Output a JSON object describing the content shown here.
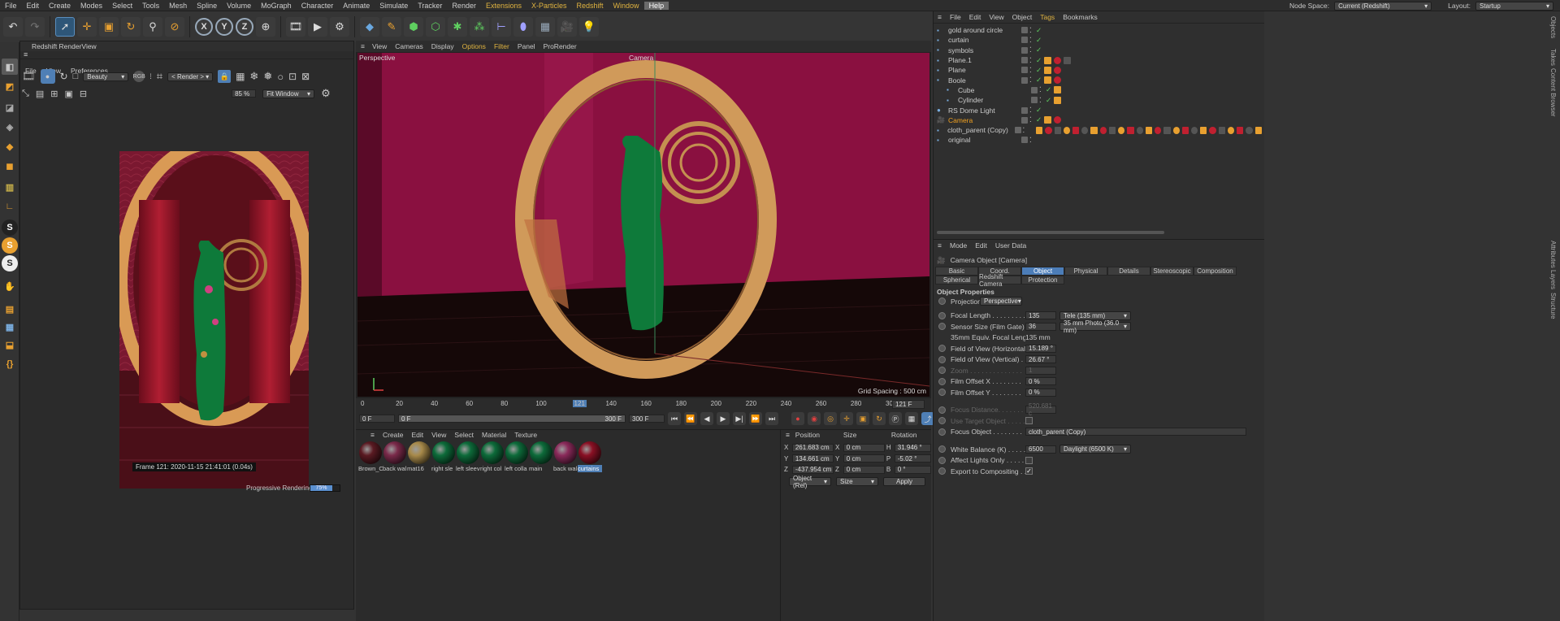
{
  "menu": [
    "File",
    "Edit",
    "Create",
    "Modes",
    "Select",
    "Tools",
    "Mesh",
    "Spline",
    "Volume",
    "MoGraph",
    "Character",
    "Animate",
    "Simulate",
    "Tracker",
    "Render",
    "Extensions",
    "X-Particles",
    "Redshift",
    "Window",
    "Help"
  ],
  "topright": {
    "node_space_label": "Node Space:",
    "node_space_value": "Current (Redshift)",
    "layout_label": "Layout:",
    "layout_value": "Startup"
  },
  "renderview": {
    "title": "Redshift RenderView",
    "menu": [
      "File",
      "View",
      "Preferences"
    ],
    "aov": "Beauty",
    "render_mode": "< Render >",
    "zoom": "85 %",
    "fit": "Fit Window",
    "frame_info": "Frame  121:  2020-11-15  21:41:01  (0.04s)",
    "status": "Progressive Rendering...",
    "progress_text": "75%"
  },
  "viewport": {
    "menu": [
      "View",
      "Cameras",
      "Display",
      "Options",
      "Filter",
      "Panel",
      "ProRender"
    ],
    "label": "Perspective",
    "camera_label": "Camera",
    "grid": "Grid Spacing : 500 cm"
  },
  "timeline": {
    "ticks": [
      "0",
      "20",
      "40",
      "60",
      "80",
      "100",
      "121",
      "140",
      "160",
      "180",
      "200",
      "220",
      "240",
      "260",
      "280",
      "300"
    ],
    "current_frame": "121 F",
    "start": "0 F",
    "start2": "0 F",
    "end": "300 F",
    "end2": "300 F"
  },
  "materials": {
    "menu": [
      "Create",
      "Edit",
      "View",
      "Select",
      "Material",
      "Texture"
    ],
    "items": [
      "Brown_C",
      "back wal",
      "mat16",
      "right sle",
      "left sleev",
      "right col",
      "left colla",
      "main",
      "back wal",
      "curtains"
    ],
    "colors": [
      "#5a1a22",
      "#7a2a4a",
      "#a88a4a",
      "#0d6b3a",
      "#0d6b3a",
      "#0d6b3a",
      "#0d6b3a",
      "#0d6b3a",
      "#8a2a5a",
      "#8a1024"
    ]
  },
  "coords": {
    "headers": [
      "Position",
      "Size",
      "Rotation"
    ],
    "rows": [
      {
        "a": "X",
        "p": "261.683 cm",
        "b": "X",
        "s": "0 cm",
        "c": "H",
        "r": "31.946 °"
      },
      {
        "a": "Y",
        "p": "134.661 cm",
        "b": "Y",
        "s": "0 cm",
        "c": "P",
        "r": "-5.02 °"
      },
      {
        "a": "Z",
        "p": "-437.954 cm",
        "b": "Z",
        "s": "0 cm",
        "c": "B",
        "r": "0 °"
      }
    ],
    "mode": "Object (Rel)",
    "size_mode": "Size",
    "apply": "Apply"
  },
  "objects": {
    "menu": [
      "File",
      "Edit",
      "View",
      "Object",
      "Tags",
      "Bookmarks"
    ],
    "items": [
      {
        "name": "gold around circle",
        "color": "#ccc"
      },
      {
        "name": "curtain",
        "color": "#ccc"
      },
      {
        "name": "symbols",
        "color": "#ccc"
      },
      {
        "name": "Plane.1",
        "color": "#ccc"
      },
      {
        "name": "Plane",
        "color": "#ccc"
      },
      {
        "name": "Boole",
        "color": "#ccc"
      },
      {
        "name": "Cube",
        "color": "#ccc"
      },
      {
        "name": "Cylinder",
        "color": "#ccc"
      },
      {
        "name": "RS Dome Light",
        "color": "#ccc"
      },
      {
        "name": "Camera",
        "color": "#f0a020"
      },
      {
        "name": "cloth_parent (Copy)",
        "color": "#ccc"
      },
      {
        "name": "original",
        "color": "#ccc"
      }
    ]
  },
  "attributes": {
    "menu": [
      "Mode",
      "Edit",
      "User Data"
    ],
    "object_title": "Camera Object [Camera]",
    "tabs": [
      "Basic",
      "Coord.",
      "Object",
      "Physical",
      "Details",
      "Stereoscopic",
      "Composition",
      "Spherical",
      "Redshift Camera",
      "Protection"
    ],
    "section": "Object Properties",
    "projection_label": "Projection",
    "projection_value": "Perspective",
    "props": [
      {
        "label": "Focal Length . . . . . . . . .",
        "value": "135",
        "extra": "Tele (135 mm)"
      },
      {
        "label": "Sensor Size (Film Gate) . .",
        "value": "36",
        "extra": "35 mm Photo (36.0 mm)"
      },
      {
        "label": "35mm Equiv. Focal Length:",
        "value": "135 mm",
        "extra": ""
      },
      {
        "label": "Field of View (Horizontal)",
        "value": "15.189 °",
        "extra": ""
      },
      {
        "label": "Field of View (Vertical) . .",
        "value": "26.67 °",
        "extra": ""
      },
      {
        "label": "Zoom . . . . . . . . . . . . . .",
        "value": "1",
        "extra": ""
      },
      {
        "label": "Film Offset X . . . . . . . .",
        "value": "0 %",
        "extra": ""
      },
      {
        "label": "Film Offset Y . . . . . . . .",
        "value": "0 %",
        "extra": ""
      },
      {
        "label": "Focus Distance. . . . . . . .",
        "value": "520.681 c",
        "extra": ""
      },
      {
        "label": "Use Target Object . . . . .",
        "value": "",
        "extra": ""
      },
      {
        "label": "Focus Object . . . . . . . .",
        "value": "cloth_parent (Copy)",
        "extra": ""
      },
      {
        "label": "White Balance (K) . . . . . .",
        "value": "6500",
        "extra": "Daylight (6500 K)"
      },
      {
        "label": "Affect Lights Only . . . . . .",
        "value": "",
        "extra": ""
      },
      {
        "label": "Export to Compositing . . . .",
        "value": "",
        "extra": ""
      }
    ]
  },
  "side_tabs": [
    "Objects",
    "Takes",
    "Content Browser",
    "Attributes",
    "Layers",
    "Structure"
  ]
}
